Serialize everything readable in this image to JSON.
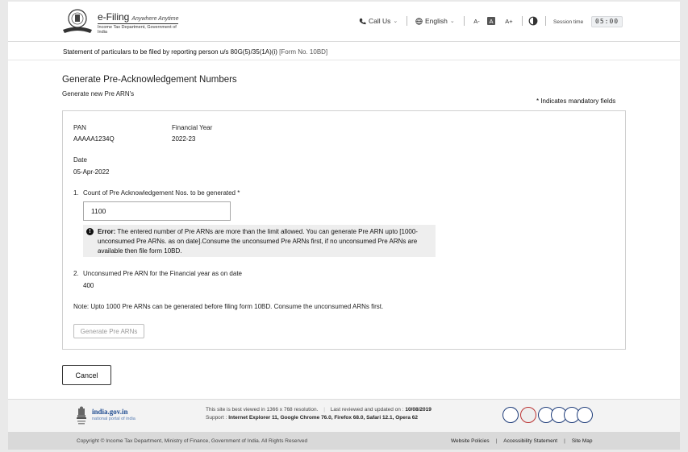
{
  "header": {
    "brand_name": "e-Filing",
    "brand_tagline": "Anywhere Anytime",
    "brand_sub": "Income Tax Department, Government of India",
    "call_us": "Call Us",
    "language": "English",
    "font_decrease": "A-",
    "font_reset": "A",
    "font_increase": "A+",
    "session_label": "Session time",
    "session_time": "05:00"
  },
  "statement": {
    "text": "Statement of particulars to be filed by  reporting person u/s 80G(5)/35(1A)(i)",
    "form_no": "[Form No. 10BD]"
  },
  "page": {
    "title": "Generate Pre-Acknowledgement Numbers",
    "subtitle": "Generate new Pre ARN's",
    "mandatory_note": "* Indicates mandatory fields"
  },
  "details": {
    "pan_label": "PAN",
    "pan_value": "AAAAA1234Q",
    "fy_label": "Financial Year",
    "fy_value": "2022-23",
    "date_label": "Date",
    "date_value": "05-Apr-2022"
  },
  "questions": {
    "q1_num": "1.",
    "q1_label": "Count of Pre Acknowledgement Nos. to be generated *",
    "q1_value": "1100",
    "error_prefix": "Error:",
    "error_text": "The entered number of Pre ARNs are more than the limit allowed. You can generate Pre ARN upto [1000-unconsumed Pre ARNs. as on date].Consume the unconsumed Pre ARNs first, if no unconsumed Pre ARNs are available then file form 10BD.",
    "q2_num": "2.",
    "q2_label": "Unconsumed Pre ARN for the Financial year as on date",
    "q2_value": "400",
    "note": "Note: Upto 1000 Pre ARNs can be generated before filing form 10BD. Consume the unconsumed ARNs first."
  },
  "buttons": {
    "generate": "Generate Pre ARNs",
    "cancel": "Cancel"
  },
  "footer": {
    "india_gov": "india.gov.in",
    "india_gov_sub": "national portal of india",
    "best_viewed": "This site is best viewed in 1366 x 768 resolution.",
    "reviewed_label": "Last reviewed and updated on :",
    "reviewed_date": "10/08/2019",
    "support_label": "Support :",
    "support_browsers": "Internet Explorer 11, Google Chrome 76.0,  Firefox 68.0, Safari 12.1, Opera 62",
    "copyright": "Copyright © Income Tax Department, Ministry of Finance, Government of India. All Rights Reserved",
    "link_policies": "Website Policies",
    "link_accessibility": "Accessibility Statement",
    "link_sitemap": "Site Map"
  },
  "colors": {
    "link_blue": "#1c4a8f",
    "error_bg": "#eeeeee",
    "footer_bg": "#f3f3f3"
  }
}
